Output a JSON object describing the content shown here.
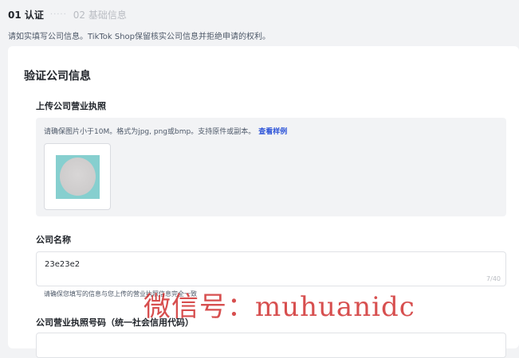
{
  "steps": {
    "step1": "01 认证",
    "dots": "·····",
    "step2": "02 基础信息"
  },
  "notice": "请如实填写公司信息。TikTok Shop保留核实公司信息并拒绝申请的权利。",
  "form": {
    "section_title": "验证公司信息",
    "license_upload": {
      "label": "上传公司营业执照",
      "hint": "请确保图片小于10M。格式为jpg, png或bmp。支持原件或副本。",
      "sample_link": "查看样例"
    },
    "company_name": {
      "label": "公司名称",
      "value": "23e23e2",
      "count": "7/40",
      "hint": "请确保您填写的信息与您上传的营业执照信息完全一致"
    },
    "license_number": {
      "label": "公司营业执照号码（统一社会信用代码）"
    }
  },
  "watermark": "微信号：muhuanidc"
}
